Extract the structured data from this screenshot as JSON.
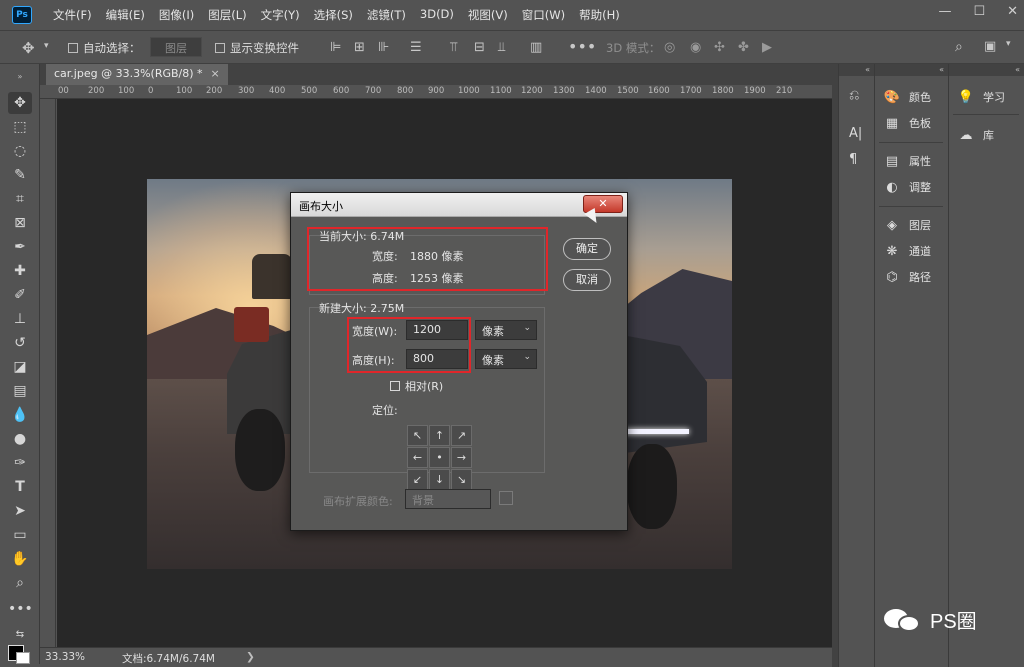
{
  "app": {
    "logo": "Ps"
  },
  "menu": [
    "文件(F)",
    "编辑(E)",
    "图像(I)",
    "图层(L)",
    "文字(Y)",
    "选择(S)",
    "滤镜(T)",
    "3D(D)",
    "视图(V)",
    "窗口(W)",
    "帮助(H)"
  ],
  "window_controls": [
    "—",
    "☐",
    "✕"
  ],
  "options_bar": {
    "auto_select_label": "自动选择：",
    "auto_select_value": "图层",
    "show_transform_label": "显示变换控件",
    "mode_3d_label": "3D 模式："
  },
  "document": {
    "tab_title": "car.jpeg @ 33.3%(RGB/8) *",
    "tab_close": "×"
  },
  "ruler_ticks": [
    "00",
    "200",
    "100",
    "0",
    "100",
    "200",
    "300",
    "400",
    "500",
    "600",
    "700",
    "800",
    "900",
    "1000",
    "1100",
    "1200",
    "1300",
    "1400",
    "1500",
    "1600",
    "1700",
    "1800",
    "1900",
    "210"
  ],
  "status": {
    "zoom": "33.33%",
    "doc_info": "文档:6.74M/6.74M",
    "arrow": "❯"
  },
  "dialog": {
    "title": "画布大小",
    "close": "✕",
    "current_size_label": "当前大小: 6.74M",
    "current_width_label": "宽度:",
    "current_width_value": "1880 像素",
    "current_height_label": "高度:",
    "current_height_value": "1253 像素",
    "new_size_label": "新建大小: 2.75M",
    "width_label": "宽度(W):",
    "width_value": "1200",
    "width_unit": "像素",
    "height_label": "高度(H):",
    "height_value": "800",
    "height_unit": "像素",
    "relative_label": "相对(R)",
    "anchor_label": "定位:",
    "anchor_arrows": [
      "↖",
      "↑",
      "↗",
      "←",
      "•",
      "→",
      "↙",
      "↓",
      "↘"
    ],
    "ext_color_label": "画布扩展颜色:",
    "ext_color_value": "背景",
    "ok_button": "确定",
    "cancel_button": "取消"
  },
  "panels": {
    "column2": [
      {
        "label": "颜色",
        "icon": "palette-icon"
      },
      {
        "label": "色板",
        "icon": "swatches-icon"
      },
      {
        "label": "属性",
        "icon": "properties-icon"
      },
      {
        "label": "调整",
        "icon": "adjustments-icon"
      },
      {
        "label": "图层",
        "icon": "layers-icon"
      },
      {
        "label": "通道",
        "icon": "channels-icon"
      },
      {
        "label": "路径",
        "icon": "paths-icon"
      }
    ],
    "column3": [
      {
        "label": "学习",
        "icon": "learn-icon"
      },
      {
        "label": "库",
        "icon": "libraries-icon"
      }
    ]
  },
  "watermark": {
    "text": "PS圈"
  }
}
